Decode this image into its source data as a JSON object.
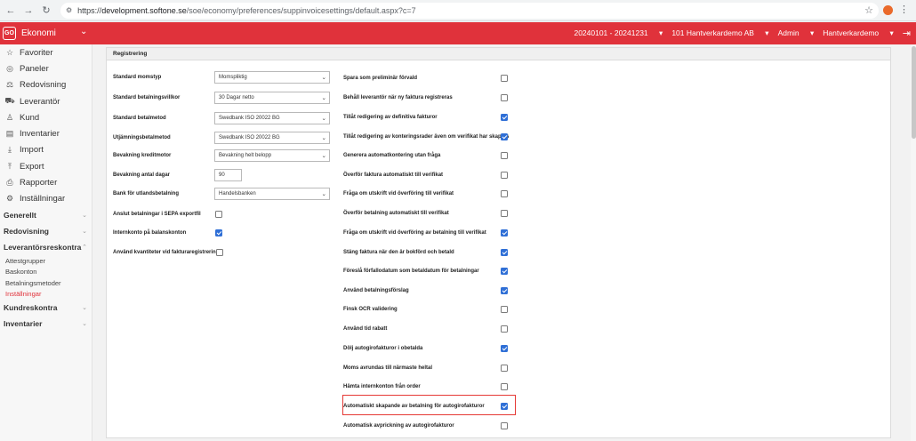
{
  "browser": {
    "url_host": "development.softone.se",
    "url_path": "/soe/economy/preferences/suppinvoicesettings/default.aspx?c=7"
  },
  "topbar": {
    "logo": "GO",
    "module": "Ekonomi",
    "period": "20240101 - 20241231",
    "company": "101 Hantverkardemo AB",
    "role": "Admin",
    "user": "Hantverkardemo"
  },
  "sidebar": {
    "items": [
      {
        "label": "Favoriter",
        "icon": "star-icon"
      },
      {
        "label": "Paneler",
        "icon": "dashboard-icon"
      },
      {
        "label": "Redovisning",
        "icon": "balance-icon"
      },
      {
        "label": "Leverantör",
        "icon": "truck-icon"
      },
      {
        "label": "Kund",
        "icon": "person-icon"
      },
      {
        "label": "Inventarier",
        "icon": "inventory-icon"
      },
      {
        "label": "Import",
        "icon": "import-icon"
      },
      {
        "label": "Export",
        "icon": "export-icon"
      },
      {
        "label": "Rapporter",
        "icon": "print-icon"
      },
      {
        "label": "Inställningar",
        "icon": "gear-icon"
      }
    ],
    "sections": {
      "generellt": "Generellt",
      "redovisning": "Redovisning",
      "leverantor": "Leverantörsreskontra",
      "kundreskontra": "Kundreskontra",
      "inventarier": "Inventarier"
    },
    "subitems": [
      "Attestgrupper",
      "Baskonton",
      "Betalningsmetoder",
      "Inställningar"
    ]
  },
  "panel": {
    "title": "Registrering",
    "left": {
      "momstyp": {
        "label": "Standard momstyp",
        "value": "Momspliktig"
      },
      "villkor": {
        "label": "Standard betalningsvillkor",
        "value": "30 Dagar netto"
      },
      "betalmetod": {
        "label": "Standard betalmetod",
        "value": "Swedbank ISO 20022 BG"
      },
      "utjamning": {
        "label": "Utjämningsbetalmetod",
        "value": "Swedbank ISO 20022 BG"
      },
      "kreditmotor": {
        "label": "Bevakning kreditmotor",
        "value": "Bevakning helt belopp"
      },
      "antal_dagar": {
        "label": "Bevakning antal dagar",
        "value": "90"
      },
      "bank": {
        "label": "Bank för utlandsbetalning",
        "value": "Handelsbanken"
      },
      "sepa": {
        "label": "Anslut betalningar i SEPA exportfil",
        "checked": false
      },
      "internkonto": {
        "label": "Internkonto på balanskonton",
        "checked": true
      },
      "kvantiteter": {
        "label": "Använd kvantiteter vid fakturaregistrering",
        "checked": false
      }
    },
    "right": [
      {
        "label": "Spara som preliminär förvald",
        "checked": false
      },
      {
        "label": "Behåll leverantör när ny faktura registreras",
        "checked": false
      },
      {
        "label": "Tillåt redigering av definitiva fakturor",
        "checked": true
      },
      {
        "label": "Tillåt redigering av konteringsrader även om verifikat har skapats",
        "checked": true
      },
      {
        "label": "Generera automatkontering utan fråga",
        "checked": false
      },
      {
        "label": "Överför faktura automatiskt till verifikat",
        "checked": false
      },
      {
        "label": "Fråga om utskrift vid överföring till verifikat",
        "checked": false
      },
      {
        "label": "Överför betalning automatiskt till verifikat",
        "checked": false
      },
      {
        "label": "Fråga om utskrift vid överföring av betalning till verifikat",
        "checked": true
      },
      {
        "label": "Stäng faktura när den är bokförd och betald",
        "checked": true
      },
      {
        "label": "Föreslå förfallodatum som betaldatum för betalningar",
        "checked": true
      },
      {
        "label": "Använd betalningsförslag",
        "checked": true
      },
      {
        "label": "Finsk OCR validering",
        "checked": false
      },
      {
        "label": "Använd tid rabatt",
        "checked": false
      },
      {
        "label": "Dölj autogirofakturor i obetalda",
        "checked": true
      },
      {
        "label": "Moms avrundas till närmaste heltal",
        "checked": false
      },
      {
        "label": "Hämta internkonton från order",
        "checked": false
      },
      {
        "label": "Automatiskt skapande av betalning för autogirofakturor",
        "checked": true
      },
      {
        "label": "Automatisk avprickning av autogirofakturor",
        "checked": false
      }
    ]
  }
}
